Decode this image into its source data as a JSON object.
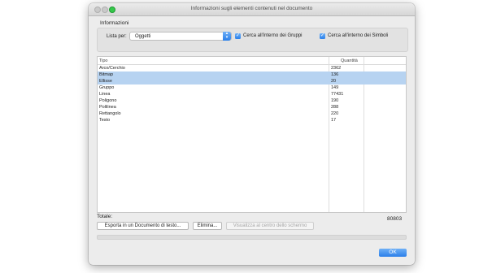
{
  "window": {
    "title": "Informazioni sugli elementi contenuti nel documento"
  },
  "options": {
    "group_label": "Informazioni",
    "list_by_label": "Lista per:",
    "list_by_value": "Oggetti",
    "check_groups_label": "Cerca all'interno dei Gruppi",
    "check_groups_checked": true,
    "check_symbols_label": "Cerca all'interno dei Simboli",
    "check_symbols_checked": true
  },
  "table": {
    "col_type": "Tipo",
    "col_qty": "Quantità",
    "rows": [
      {
        "name": "Arco/Cerchio",
        "qty": "2362",
        "selected": false
      },
      {
        "name": "Bitmap",
        "qty": "136",
        "selected": true
      },
      {
        "name": "Ellisse",
        "qty": "20",
        "selected": true
      },
      {
        "name": "Gruppo",
        "qty": "149",
        "selected": false
      },
      {
        "name": "Linea",
        "qty": "77431",
        "selected": false
      },
      {
        "name": "Poligono",
        "qty": "190",
        "selected": false
      },
      {
        "name": "Polilinea",
        "qty": "288",
        "selected": false
      },
      {
        "name": "Rettangolo",
        "qty": "220",
        "selected": false
      },
      {
        "name": "Testo",
        "qty": "17",
        "selected": false
      }
    ]
  },
  "totals": {
    "label": "Totale:",
    "value": "80803"
  },
  "buttons": {
    "export": "Esporta in un Documento di testo...",
    "delete": "Elimina...",
    "show_center": "Visualizza al centro dello schermo",
    "ok": "OK"
  },
  "colors": {
    "accent": "#2a7fe9",
    "selection": "#b7d3f1",
    "zoom_light": "#34c84a"
  }
}
